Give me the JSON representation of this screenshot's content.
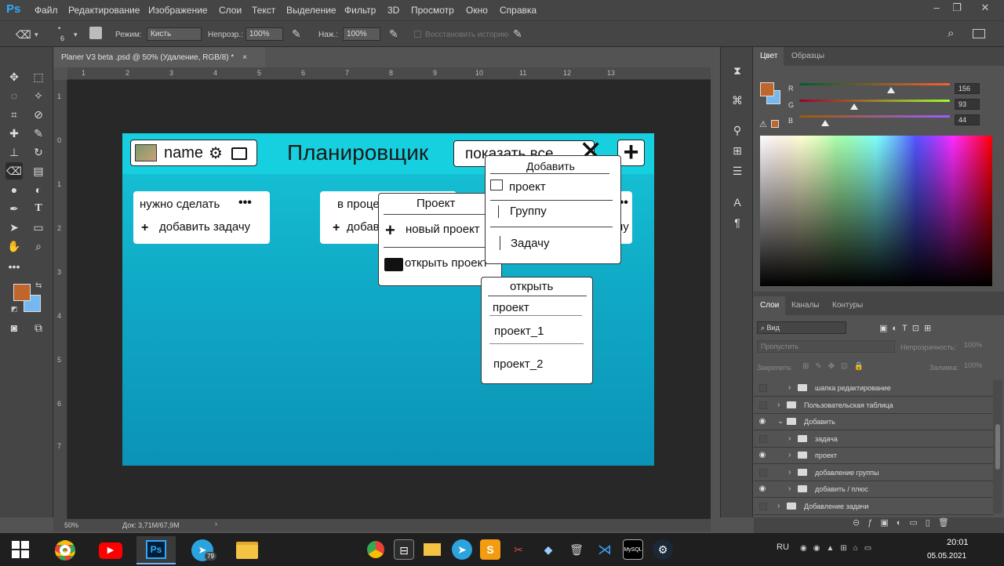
{
  "app": {
    "logo": "Ps",
    "menu": [
      "Файл",
      "Редактирование",
      "Изображение",
      "Слои",
      "Текст",
      "Выделение",
      "Фильтр",
      "3D",
      "Просмотр",
      "Окно",
      "Справка"
    ],
    "window_controls": [
      "–",
      "❐",
      "✕"
    ]
  },
  "options": {
    "brush_size": "6",
    "mode_label": "Режим:",
    "mode_value": "Кисть",
    "opacity_label": "Непрозр.:",
    "opacity_value": "100%",
    "pressure_label": "Наж.:",
    "pressure_value": "100%",
    "history_label": "Восстановить историю"
  },
  "document": {
    "tab_title": "Planer V3 beta .psd @ 50% (Удаление, RGB/8) *",
    "tab_close": "×",
    "ruler_top": [
      "1",
      "2",
      "3",
      "4",
      "5",
      "6",
      "7",
      "8",
      "9",
      "10",
      "11",
      "12",
      "13"
    ],
    "ruler_left": [
      "1",
      "0",
      "1",
      "2",
      "3",
      "4",
      "5",
      "6",
      "7"
    ],
    "zoom": "50%",
    "doc_size": "Док: 3,71M/67,9M"
  },
  "design": {
    "user_name": "name",
    "app_title": "Планировщик",
    "filter_button": "показать все",
    "close_glyph": "✕",
    "plus_glyph": "+",
    "col1_title": "нужно сделать",
    "col1_dots": "•••",
    "col1_add": "добавить задачу",
    "col2_title": "в процесс",
    "col2_add": "добавить",
    "col3_dots": "•••",
    "col3_add": "ну",
    "project_menu": {
      "title": "Проект",
      "new": "новый проект",
      "open": "открыть проект"
    },
    "add_menu": {
      "title": "Добавить",
      "items": [
        "проект",
        "Группу",
        "Задачу"
      ]
    },
    "open_menu": {
      "title": "открыть",
      "items": [
        "проект",
        "проект_1",
        "проект_2"
      ]
    }
  },
  "color_panel": {
    "tabs": [
      "Цвет",
      "Образцы"
    ],
    "r_label": "R",
    "g_label": "G",
    "b_label": "B",
    "r": 156,
    "g": 93,
    "b": 44,
    "r_text": "156",
    "g_text": "93",
    "b_text": "44",
    "foreground": "#c0652b",
    "background": "#75b8f0"
  },
  "layers_panel": {
    "tabs": [
      "Слои",
      "Каналы",
      "Контуры"
    ],
    "kind_filter": "Вид",
    "blend_mode": "Пропустить",
    "opacity_label": "Непрозрачность:",
    "opacity_value": "100%",
    "lock_label": "Закрепить:",
    "fill_label": "Заливка:",
    "fill_value": "100%",
    "layers": [
      {
        "name": "шапка редактирование",
        "visible": false,
        "indent": 1,
        "expanded": false
      },
      {
        "name": "Пользовательская таблица",
        "visible": false,
        "indent": 0,
        "expanded": false
      },
      {
        "name": "Добавить",
        "visible": true,
        "indent": 0,
        "expanded": true
      },
      {
        "name": "задача",
        "visible": false,
        "indent": 1,
        "expanded": false
      },
      {
        "name": "проект",
        "visible": true,
        "indent": 1,
        "expanded": false
      },
      {
        "name": "добавление группы",
        "visible": false,
        "indent": 1,
        "expanded": false
      },
      {
        "name": "добавить / плюс",
        "visible": true,
        "indent": 1,
        "expanded": false
      },
      {
        "name": "Добавление задачи",
        "visible": false,
        "indent": 0,
        "expanded": false
      }
    ]
  },
  "taskbar": {
    "lang": "RU",
    "time": "20:01",
    "date": "05.05.2021",
    "telegram_badge": "79",
    "ps_label": "Ps",
    "mysql_label": "MySQL"
  }
}
